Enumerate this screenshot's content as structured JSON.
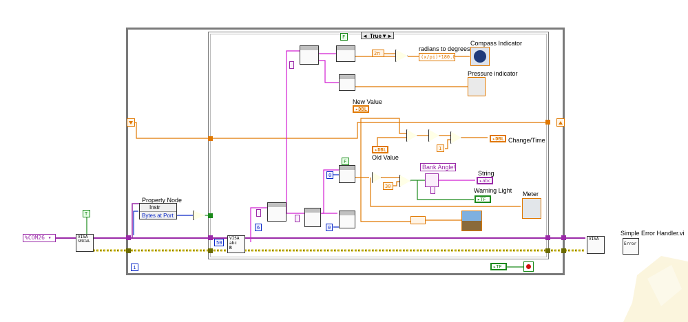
{
  "case_selector": {
    "value": "True",
    "left_arrow": "◄",
    "right_arrow": "▼►"
  },
  "constants": {
    "false_top": "F",
    "false_mid": "F",
    "true_top": "T",
    "two_pi": "2π",
    "one": "1",
    "thirty": "30",
    "zero_a": "0",
    "zero_b": "0",
    "six": "6",
    "fifty": "50",
    "formula": "(x/pi)*180.0",
    "bank_angle": "Bank Angle!",
    "loop_index": "i",
    "tf_stop": "TF"
  },
  "labels": {
    "radians_to_degrees": "radians to degrees",
    "compass": "Compass Indicator",
    "pressure": "Pressure indicator",
    "new_value": "New Value",
    "old_value": "Old Value",
    "change_time": "Change/Time",
    "string": "String",
    "warning_light": "Warning Light",
    "meter": "Meter",
    "property_node": "Property Node",
    "simple_error": "Simple Error Handler.vi"
  },
  "terminals": {
    "dbl": "DBL",
    "abc": "abc",
    "tf": "TF",
    "dbl_new": "DBL",
    "dbl_old": "DBL",
    "dbl_change": "DBL"
  },
  "property_node": {
    "class": "Instr",
    "property": "Bytes at Port"
  },
  "visa": {
    "resource": "COM26",
    "prefix": "%",
    "serial": "SERIAL",
    "visa": "VISA",
    "read_abc": "abc",
    "read_r": "R"
  },
  "error_handler": {
    "text": "Error"
  },
  "colors": {
    "wire_orange": "#e07800",
    "wire_pink": "#d21fd2",
    "wire_blue": "#0a28c8",
    "wire_green": "#1b8a1b",
    "wire_yellow": "#c8b400",
    "frame": "#7a7a7a"
  }
}
